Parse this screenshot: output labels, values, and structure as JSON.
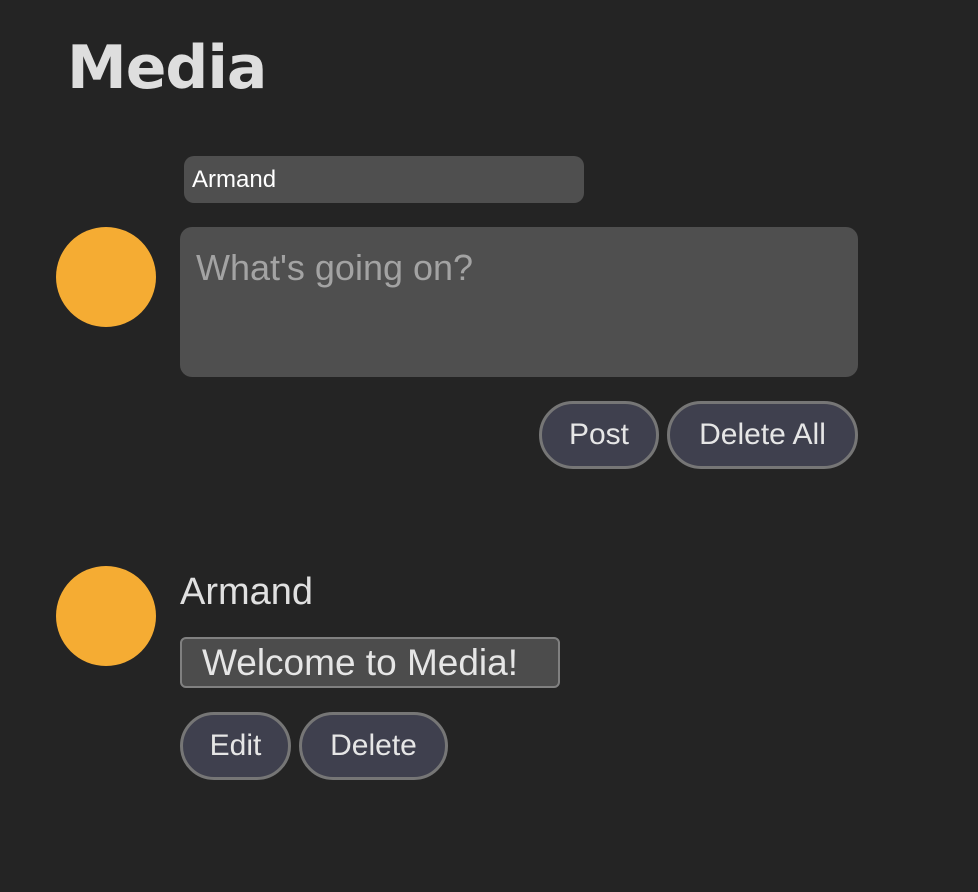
{
  "header": {
    "title": "Media"
  },
  "composer": {
    "name_value": "Armand",
    "textarea_placeholder": "What's going on?",
    "post_label": "Post",
    "delete_all_label": "Delete All",
    "avatar_color": "#f5ac33"
  },
  "posts": [
    {
      "author": "Armand",
      "content": "Welcome to Media!",
      "edit_label": "Edit",
      "delete_label": "Delete",
      "avatar_color": "#f5ac33"
    }
  ],
  "colors": {
    "background": "#242424",
    "input_background": "#4f4f4f",
    "button_background": "#3f404e",
    "button_border": "#767676",
    "avatar": "#f5ac33"
  }
}
